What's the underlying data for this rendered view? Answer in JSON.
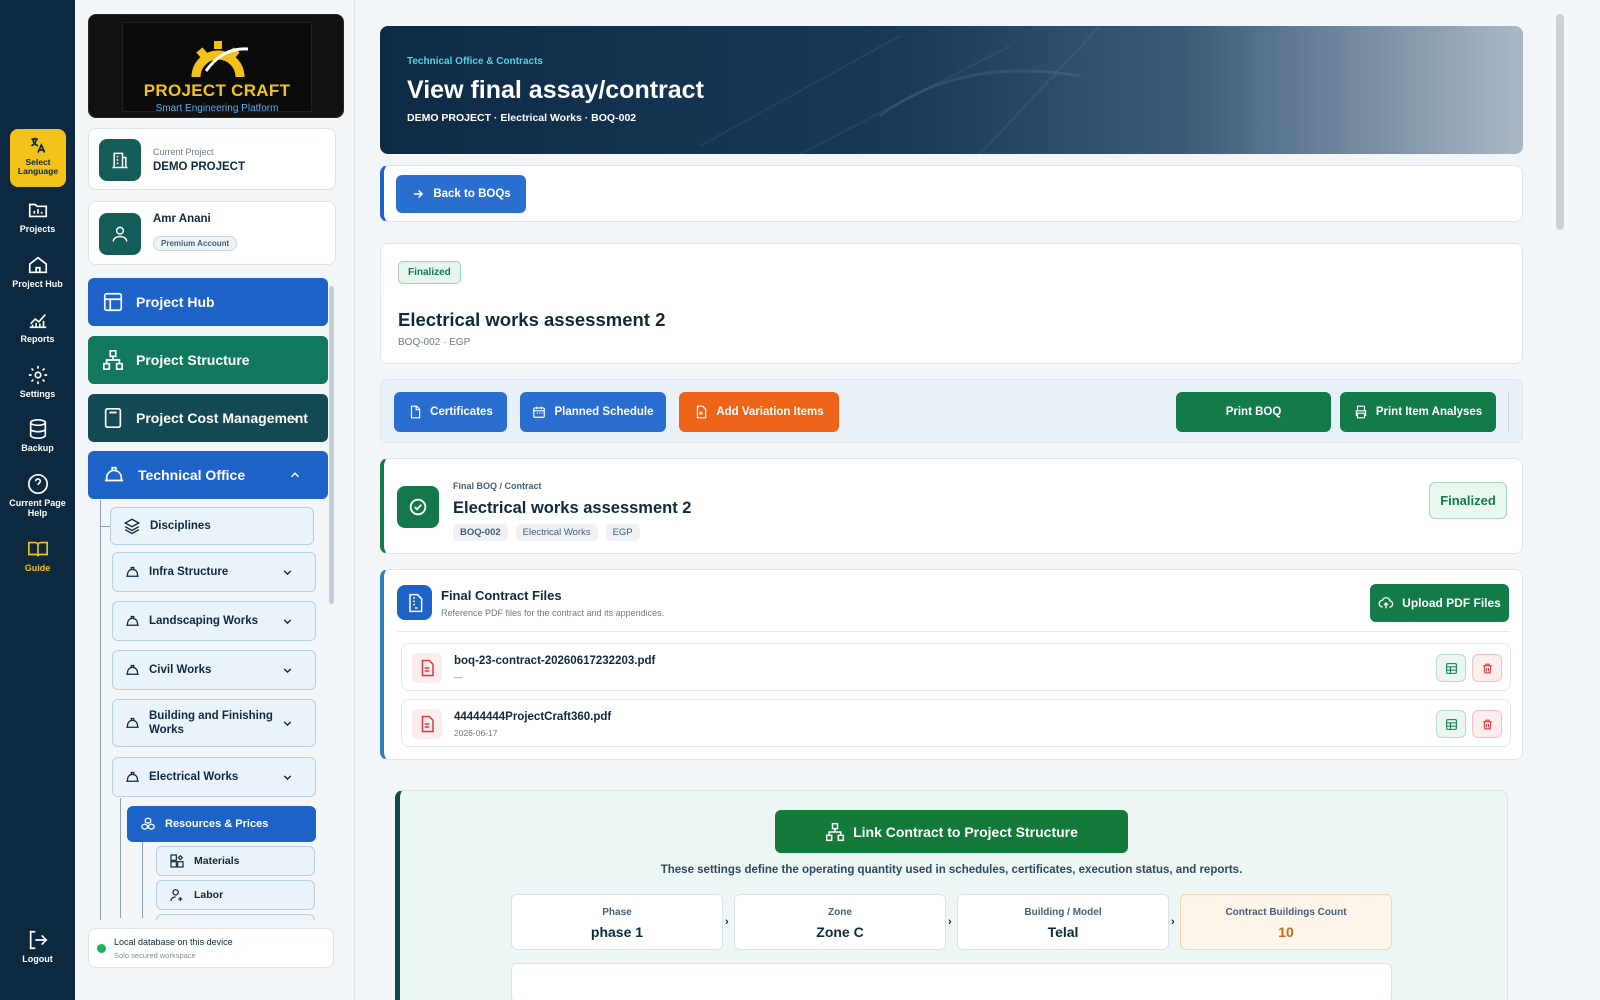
{
  "rail": {
    "language": "Select Language",
    "projects": "Projects",
    "hub": "Project Hub",
    "reports": "Reports",
    "settings": "Settings",
    "backup": "Backup",
    "help": "Current Page Help",
    "guide": "Guide",
    "logout": "Logout"
  },
  "logo": {
    "title": "PROJECT CRAFT",
    "subtitle": "Smart Engineering Platform"
  },
  "project_card": {
    "label": "Current Project",
    "name": "DEMO PROJECT"
  },
  "user_card": {
    "name": "Amr Anani",
    "plan": "Premium Account"
  },
  "nav": {
    "hub": "Project Hub",
    "structure": "Project Structure",
    "cost": "Project Cost Management",
    "technical": "Technical Office",
    "disciplines": "Disciplines",
    "infra": "Infra Structure",
    "landscaping": "Landscaping Works",
    "civil": "Civil Works",
    "building": "Building and Finishing Works",
    "electrical": "Electrical Works",
    "resources": "Resources & Prices",
    "materials": "Materials",
    "labor": "Labor"
  },
  "db_status": {
    "title": "Local database on this device",
    "subtitle": "Solo secured workspace"
  },
  "hero": {
    "kicker": "Technical Office & Contracts",
    "title": "View final assay/contract",
    "subtitle": "DEMO PROJECT · Electrical Works · BOQ-002"
  },
  "back_button": "Back to BOQs",
  "summary": {
    "status": "Finalized",
    "title": "Electrical works assessment 2",
    "meta": "BOQ-002 · EGP"
  },
  "actions": {
    "certificates": "Certificates",
    "schedule": "Planned Schedule",
    "variation": "Add Variation Items",
    "print_boq": "Print BOQ",
    "print_analyses": "Print Item Analyses"
  },
  "final_card": {
    "kicker": "Final BOQ / Contract",
    "title": "Electrical works assessment 2",
    "tags": [
      "BOQ-002",
      "Electrical Works",
      "EGP"
    ],
    "status": "Finalized"
  },
  "files": {
    "title": "Final Contract Files",
    "subtitle": "Reference PDF files for the contract and its appendices.",
    "upload": "Upload PDF Files",
    "items": [
      {
        "name": "boq-23-contract-20260617232203.pdf",
        "date": "—"
      },
      {
        "name": "44444444ProjectCraft360.pdf",
        "date": "2026-06-17"
      }
    ]
  },
  "link": {
    "button": "Link Contract to Project Structure",
    "note": "These settings define the operating quantity used in schedules, certificates, execution status, and reports.",
    "stats": [
      {
        "label": "Phase",
        "value": "phase 1"
      },
      {
        "label": "Zone",
        "value": "Zone C"
      },
      {
        "label": "Building / Model",
        "value": "Telal"
      },
      {
        "label": "Contract Buildings Count",
        "value": "10"
      }
    ]
  },
  "colors": {
    "navy": "#0d2940",
    "blue": "#1d63c8",
    "green": "#137a4a",
    "orange": "#ee6418",
    "teal": "#145c57",
    "yellow": "#f2c21a"
  }
}
